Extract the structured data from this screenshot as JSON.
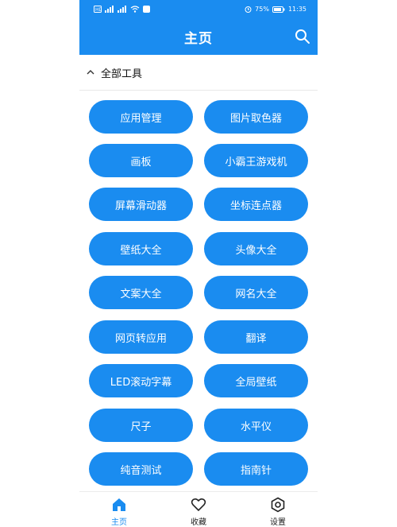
{
  "status_bar": {
    "left_icons": [
      "sim-icon",
      "signal-icon",
      "signal-icon",
      "wifi-icon",
      "app-icon"
    ],
    "right_icons": [
      "alarm-icon"
    ],
    "battery": "75%",
    "time": "11:35"
  },
  "header": {
    "title": "主页",
    "search_icon": "search-icon",
    "background": "#1a8cf0"
  },
  "section": {
    "label": "全部工具",
    "icon": "chevron-up-icon",
    "expanded": true
  },
  "tools": [
    "应用管理",
    "图片取色器",
    "画板",
    "小霸王游戏机",
    "屏幕滑动器",
    "坐标连点器",
    "壁纸大全",
    "头像大全",
    "文案大全",
    "网名大全",
    "网页转应用",
    "翻译",
    "LED滚动字幕",
    "全局壁纸",
    "尺子",
    "水平仪",
    "纯音测试",
    "指南针"
  ],
  "bottom_nav": {
    "items": [
      {
        "label": "主页",
        "icon": "home-icon",
        "active": true
      },
      {
        "label": "收藏",
        "icon": "heart-icon",
        "active": false
      },
      {
        "label": "设置",
        "icon": "settings-icon",
        "active": false
      }
    ],
    "active_color": "#1a8cf0",
    "inactive_color": "#222222"
  }
}
